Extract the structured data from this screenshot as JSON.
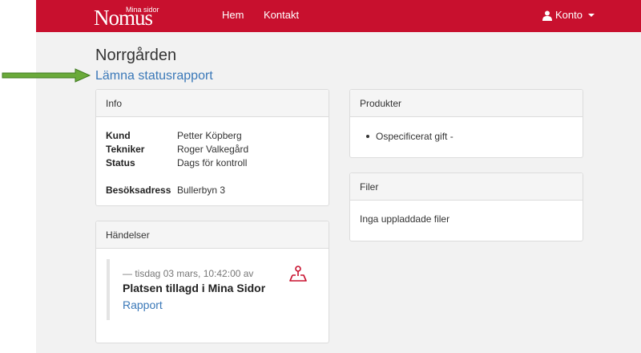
{
  "nav": {
    "brand_main": "Nomus",
    "brand_sub": "Mina sidor",
    "home": "Hem",
    "contact": "Kontakt",
    "account": "Konto"
  },
  "page": {
    "title": "Norrgården",
    "status_link": "Lämna statusrapport"
  },
  "info": {
    "heading": "Info",
    "rows": [
      {
        "label": "Kund",
        "value": "Petter Köpberg"
      },
      {
        "label": "Tekniker",
        "value": "Roger Valkegård"
      },
      {
        "label": "Status",
        "value": "Dags för kontroll"
      },
      {
        "label": "Besöksadress",
        "value": "Bullerbyn 3"
      }
    ]
  },
  "products": {
    "heading": "Produkter",
    "items": [
      "Ospecificerat gift -"
    ]
  },
  "files": {
    "heading": "Filer",
    "empty": "Inga uppladdade filer"
  },
  "events": {
    "heading": "Händelser",
    "items": [
      {
        "meta": "— tisdag 03 mars, 10:42:00 av",
        "title": "Platsen tillagd i Mina Sidor",
        "link": "Rapport",
        "icon": "map-pin-icon"
      }
    ]
  },
  "colors": {
    "brand_red": "#c8102e",
    "link_blue": "#3a78b8",
    "arrow_green": "#5b9a2f",
    "icon_red": "#c8102e"
  }
}
